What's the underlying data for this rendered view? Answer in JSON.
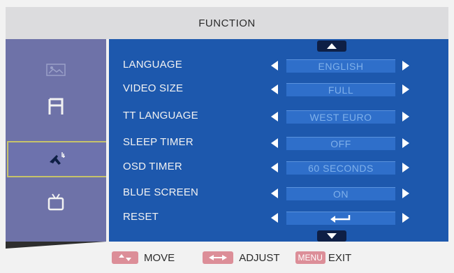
{
  "header": {
    "title": "FUNCTION"
  },
  "sidebar": {
    "items": [
      {
        "icon": "picture-icon",
        "selected": false
      },
      {
        "icon": "screen-icon",
        "selected": false
      },
      {
        "icon": "wrench-icon",
        "selected": true
      },
      {
        "icon": "tv-icon",
        "selected": false
      }
    ]
  },
  "menu": {
    "rows": [
      {
        "label": "LANGUAGE",
        "value": "ENGLISH"
      },
      {
        "label": "VIDEO SIZE",
        "value": "FULL"
      },
      {
        "label": "TT LANGUAGE",
        "value": "WEST EURO"
      },
      {
        "label": "SLEEP TIMER",
        "value": "OFF"
      },
      {
        "label": "OSD TIMER",
        "value": "60 SECONDS"
      },
      {
        "label": "BLUE SCREEN",
        "value": "ON"
      },
      {
        "label": "RESET",
        "value": ""
      }
    ]
  },
  "footer": {
    "move_label": "MOVE",
    "adjust_label": "ADJUST",
    "menu_key": "MENU",
    "exit_label": "EXIT"
  },
  "colors": {
    "panel": "#1d58ad",
    "sidebar": "#6e72a8",
    "key": "#dc8e98"
  }
}
